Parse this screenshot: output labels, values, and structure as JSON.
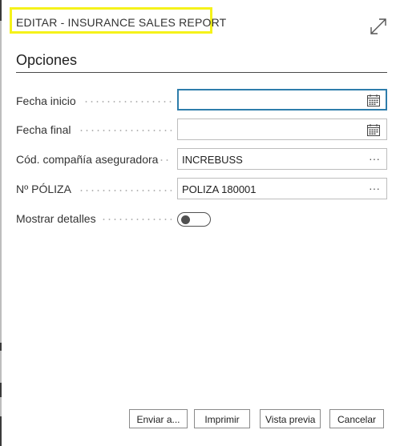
{
  "dialog": {
    "title": "EDITAR - INSURANCE SALES REPORT",
    "section_title": "Opciones",
    "highlight_color": "#f5f21a",
    "expand_icon": "expand-arrows-icon"
  },
  "fields": {
    "fecha_inicio": {
      "label": "Fecha inicio",
      "value": ""
    },
    "fecha_final": {
      "label": "Fecha final",
      "value": ""
    },
    "cod_compania": {
      "label": "Cód. compañía aseguradora",
      "value": "INCREBUSS",
      "lookup": "···"
    },
    "num_poliza": {
      "label": "Nº PÓLIZA",
      "value": "POLIZA 180001",
      "lookup": "···"
    },
    "mostrar_detalles": {
      "label": "Mostrar detalles",
      "value": false
    }
  },
  "buttons": {
    "enviar": "Enviar a...",
    "imprimir": "Imprimir",
    "vista_previa": "Vista previa",
    "cancelar": "Cancelar"
  },
  "colors": {
    "focus_border": "#2e7dab",
    "section_rule": "#4a4a4a"
  }
}
